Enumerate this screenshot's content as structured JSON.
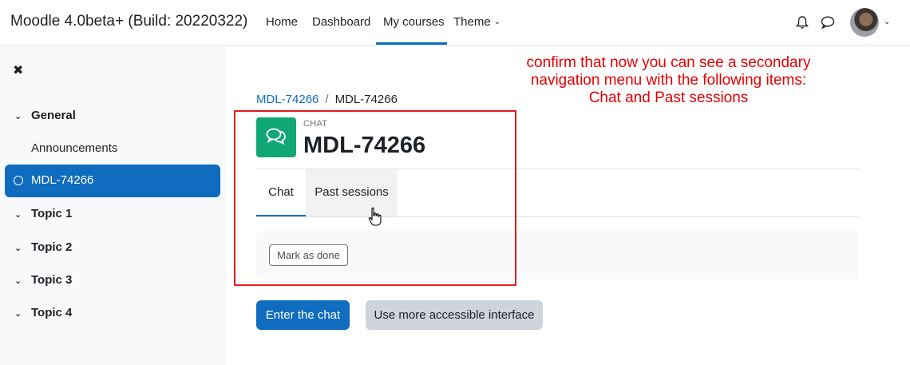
{
  "header": {
    "brand": "Moodle 4.0beta+ (Build: 20220322)",
    "nav": [
      {
        "label": "Home"
      },
      {
        "label": "Dashboard"
      },
      {
        "label": "My courses"
      },
      {
        "label": "Theme"
      }
    ],
    "icons": [
      "bell-icon",
      "chat-bubble-icon",
      "avatar",
      "chevron-down-icon"
    ]
  },
  "sidebar": {
    "close_icon": "✖",
    "sections": [
      {
        "label": "General"
      },
      {
        "label": "Topic 1"
      },
      {
        "label": "Topic 2"
      },
      {
        "label": "Topic 3"
      },
      {
        "label": "Topic 4"
      }
    ],
    "items": [
      {
        "label": "Announcements"
      },
      {
        "label": "MDL-74266"
      }
    ]
  },
  "main": {
    "breadcrumb": {
      "link": "MDL-74266",
      "sep": "/",
      "current": "MDL-74266"
    },
    "module_type": "CHAT",
    "title": "MDL-74266",
    "tabs": [
      {
        "label": "Chat"
      },
      {
        "label": "Past sessions"
      }
    ],
    "mark_done": "Mark as done",
    "enter_chat": "Enter the chat",
    "accessible": "Use more accessible interface"
  },
  "annotation": {
    "text": "confirm that now you can see a secondary navigation menu with the following items: Chat and Past sessions",
    "color": "#e60000"
  },
  "colors": {
    "primary": "#0f6cbf",
    "chat_icon_bg": "#11a676"
  }
}
